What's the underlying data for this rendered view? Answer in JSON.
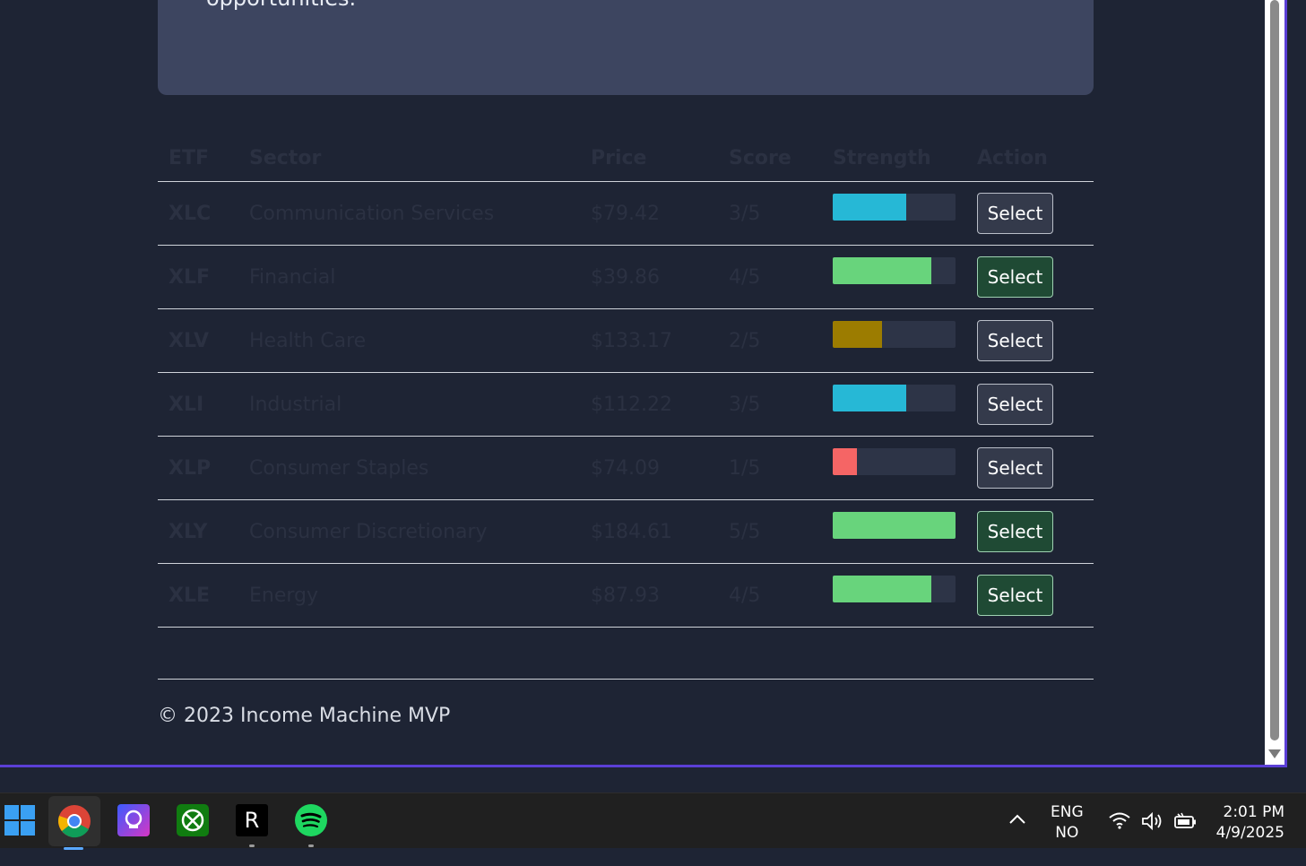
{
  "hero": {
    "text": "opportunities."
  },
  "table": {
    "headers": [
      "ETF",
      "Sector",
      "Price",
      "Score",
      "Strength",
      "Action"
    ],
    "rows": [
      {
        "etf": "XLC",
        "sector": "Communication Services",
        "price": "$79.42",
        "score": "3/5",
        "strength": 0.6,
        "color": "#26b8d6",
        "action": "Select",
        "recommended": false
      },
      {
        "etf": "XLF",
        "sector": "Financial",
        "price": "$39.86",
        "score": "4/5",
        "strength": 0.8,
        "color": "#68d47c",
        "action": "Select",
        "recommended": true
      },
      {
        "etf": "XLV",
        "sector": "Health Care",
        "price": "$133.17",
        "score": "2/5",
        "strength": 0.4,
        "color": "#9c7c00",
        "action": "Select",
        "recommended": false
      },
      {
        "etf": "XLI",
        "sector": "Industrial",
        "price": "$112.22",
        "score": "3/5",
        "strength": 0.6,
        "color": "#26b8d6",
        "action": "Select",
        "recommended": false
      },
      {
        "etf": "XLP",
        "sector": "Consumer Staples",
        "price": "$74.09",
        "score": "1/5",
        "strength": 0.2,
        "color": "#f56565",
        "action": "Select",
        "recommended": false
      },
      {
        "etf": "XLY",
        "sector": "Consumer Discretionary",
        "price": "$184.61",
        "score": "5/5",
        "strength": 1.0,
        "color": "#68d47c",
        "action": "Select",
        "recommended": true
      },
      {
        "etf": "XLE",
        "sector": "Energy",
        "price": "$87.93",
        "score": "4/5",
        "strength": 0.8,
        "color": "#68d47c",
        "action": "Select",
        "recommended": true
      }
    ]
  },
  "footer": {
    "text": "© 2023 Income Machine MVP"
  },
  "taskbar": {
    "apps": [
      "windows-start-icon",
      "chrome-icon",
      "app-icon",
      "xbox-icon",
      "r-app-icon",
      "spotify-icon"
    ],
    "r_label": "R",
    "lang_top": "ENG",
    "lang_bottom": "NO",
    "time": "2:01 PM",
    "date": "4/9/2025"
  }
}
